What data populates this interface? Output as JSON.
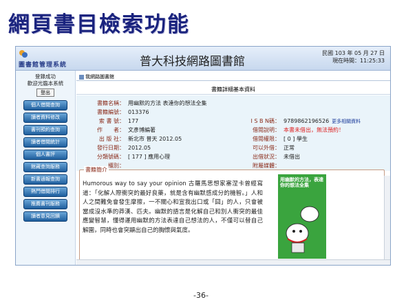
{
  "slide": {
    "title": "網頁書目檢索功能",
    "page_number": "-36-"
  },
  "app": {
    "system_name": "圖書館管理系統",
    "library_name": "普大科技網路圖書館",
    "date_line": "民國 103 年 05 月 27 日",
    "time_line": "現在時間：11:25:33"
  },
  "sidebar": {
    "login_status": "登錄成功",
    "welcome": "歡迎光臨本系統",
    "logout_label": "登出",
    "menu_items": [
      {
        "label": "個人借閱查詢"
      },
      {
        "label": "讀者資料修改"
      },
      {
        "label": "書刊預約查詢"
      },
      {
        "label": "讀者借閱統計"
      },
      {
        "label": "個人書評"
      },
      {
        "label": "館藏查詢服務"
      },
      {
        "label": "新書通報查詢"
      },
      {
        "label": "熱門借閱排行"
      },
      {
        "label": "推薦書刊服務"
      },
      {
        "label": "讀者意見回饋"
      }
    ]
  },
  "breadcrumb": {
    "text": "我網路圖書館"
  },
  "panel": {
    "title": "書籍詳細基本資料"
  },
  "book": {
    "left_labels": [
      "書籍名稱：",
      "書籍編號：",
      "索 書 號：",
      "作　　者：",
      "出 版 社：",
      "發行日期：",
      "分類號碼：",
      "櫃別："
    ],
    "left_values": [
      "用幽默的方法 表達你的想法全集",
      "013376",
      "177",
      "文彥博編著",
      "新北市 普天 2012.05",
      "2012.05",
      "[ 177 ] 應用心理",
      ""
    ],
    "right_labels": [
      "I S B N碼：",
      "借閱說明：",
      "借閱權限：",
      "可以外借：",
      "出借狀況：",
      "附屬媒體："
    ],
    "right_values": [
      "9789862196526",
      "本書未借出，無法預約！",
      "[ 0 ] 學生",
      "正常",
      "未借出",
      ""
    ],
    "more_link": "更多相關資料"
  },
  "summary": {
    "title": "書籍簡介",
    "text": "Humorous way to say your opinion 古羅馬思想家塞涅卡曾經寫道：「化解人際衝突的最好良藥，就是含有幽默感成分的機智。」人和人之間難免會發生摩擦，一不關心和宣我出口或「囧」的人，只會被當成沒水準的莽漢、匹夫。幽默的語言是化解自己和別人衝突的最佳應變智慧，懂得運用幽默的方法表達自己想法的人，不僅可以替自己解圍，同時也會突顯出自己的胸懷與氣度。"
  },
  "cover": {
    "title": "用幽默的方法，表達你的想法全集"
  },
  "colors": {
    "title": "#1a237e",
    "label": "#8a2b1a",
    "warning": "#dd2222",
    "button": "#1f5f9e",
    "cover": "#3aa43e"
  }
}
